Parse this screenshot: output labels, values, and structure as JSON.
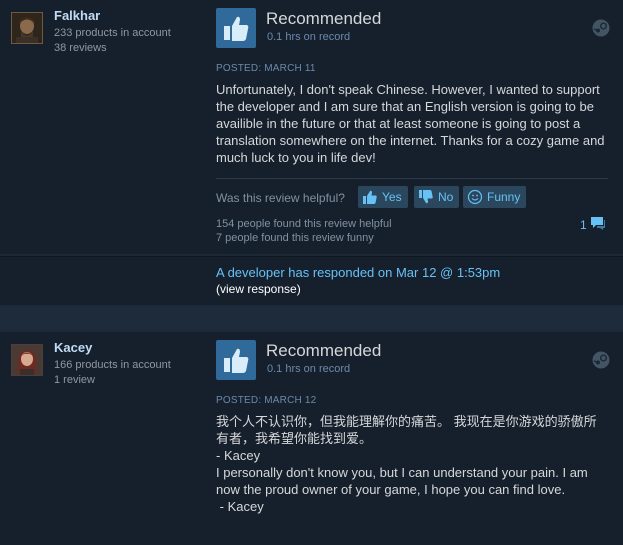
{
  "reviews": [
    {
      "author": "Falkhar",
      "products": "233 products in account",
      "reviews_count": "38 reviews",
      "recommendation": "Recommended",
      "hours": "0.1 hrs on record",
      "posted": "POSTED: MARCH 11",
      "text": "Unfortunately, I don't speak Chinese. However, I wanted to support the developer and I am sure that an English version is going to be availible in the future or that at least someone is going to post a translation somewhere on the internet. Thanks for a cozy game and much luck to you in life dev!",
      "helpful_prompt": "Was this review helpful?",
      "yes_label": "Yes",
      "no_label": "No",
      "funny_label": "Funny",
      "helpful_stat": "154 people found this review helpful",
      "funny_stat": "7 people found this review funny",
      "comments": "1"
    },
    {
      "author": "Kacey",
      "products": "166 products in account",
      "reviews_count": "1 review",
      "recommendation": "Recommended",
      "hours": "0.1 hrs on record",
      "posted": "POSTED: MARCH 12",
      "text": "我个人不认识你，但我能理解你的痛苦。 我现在是你游戏的骄傲所有者，我希望你能找到爱。\n- Kacey\nI personally don't know you, but I can understand your pain. I am now the proud owner of your game, I hope you can find love.\n - Kacey"
    }
  ],
  "dev_response": {
    "link_text": "A developer has responded on Mar 12 @ 1:53pm",
    "view_text": "(view response)"
  },
  "colors": {
    "background": "#1b2838",
    "card": "#16202d",
    "link": "#67c1f5",
    "thumb_box": "#2f6a9a"
  }
}
